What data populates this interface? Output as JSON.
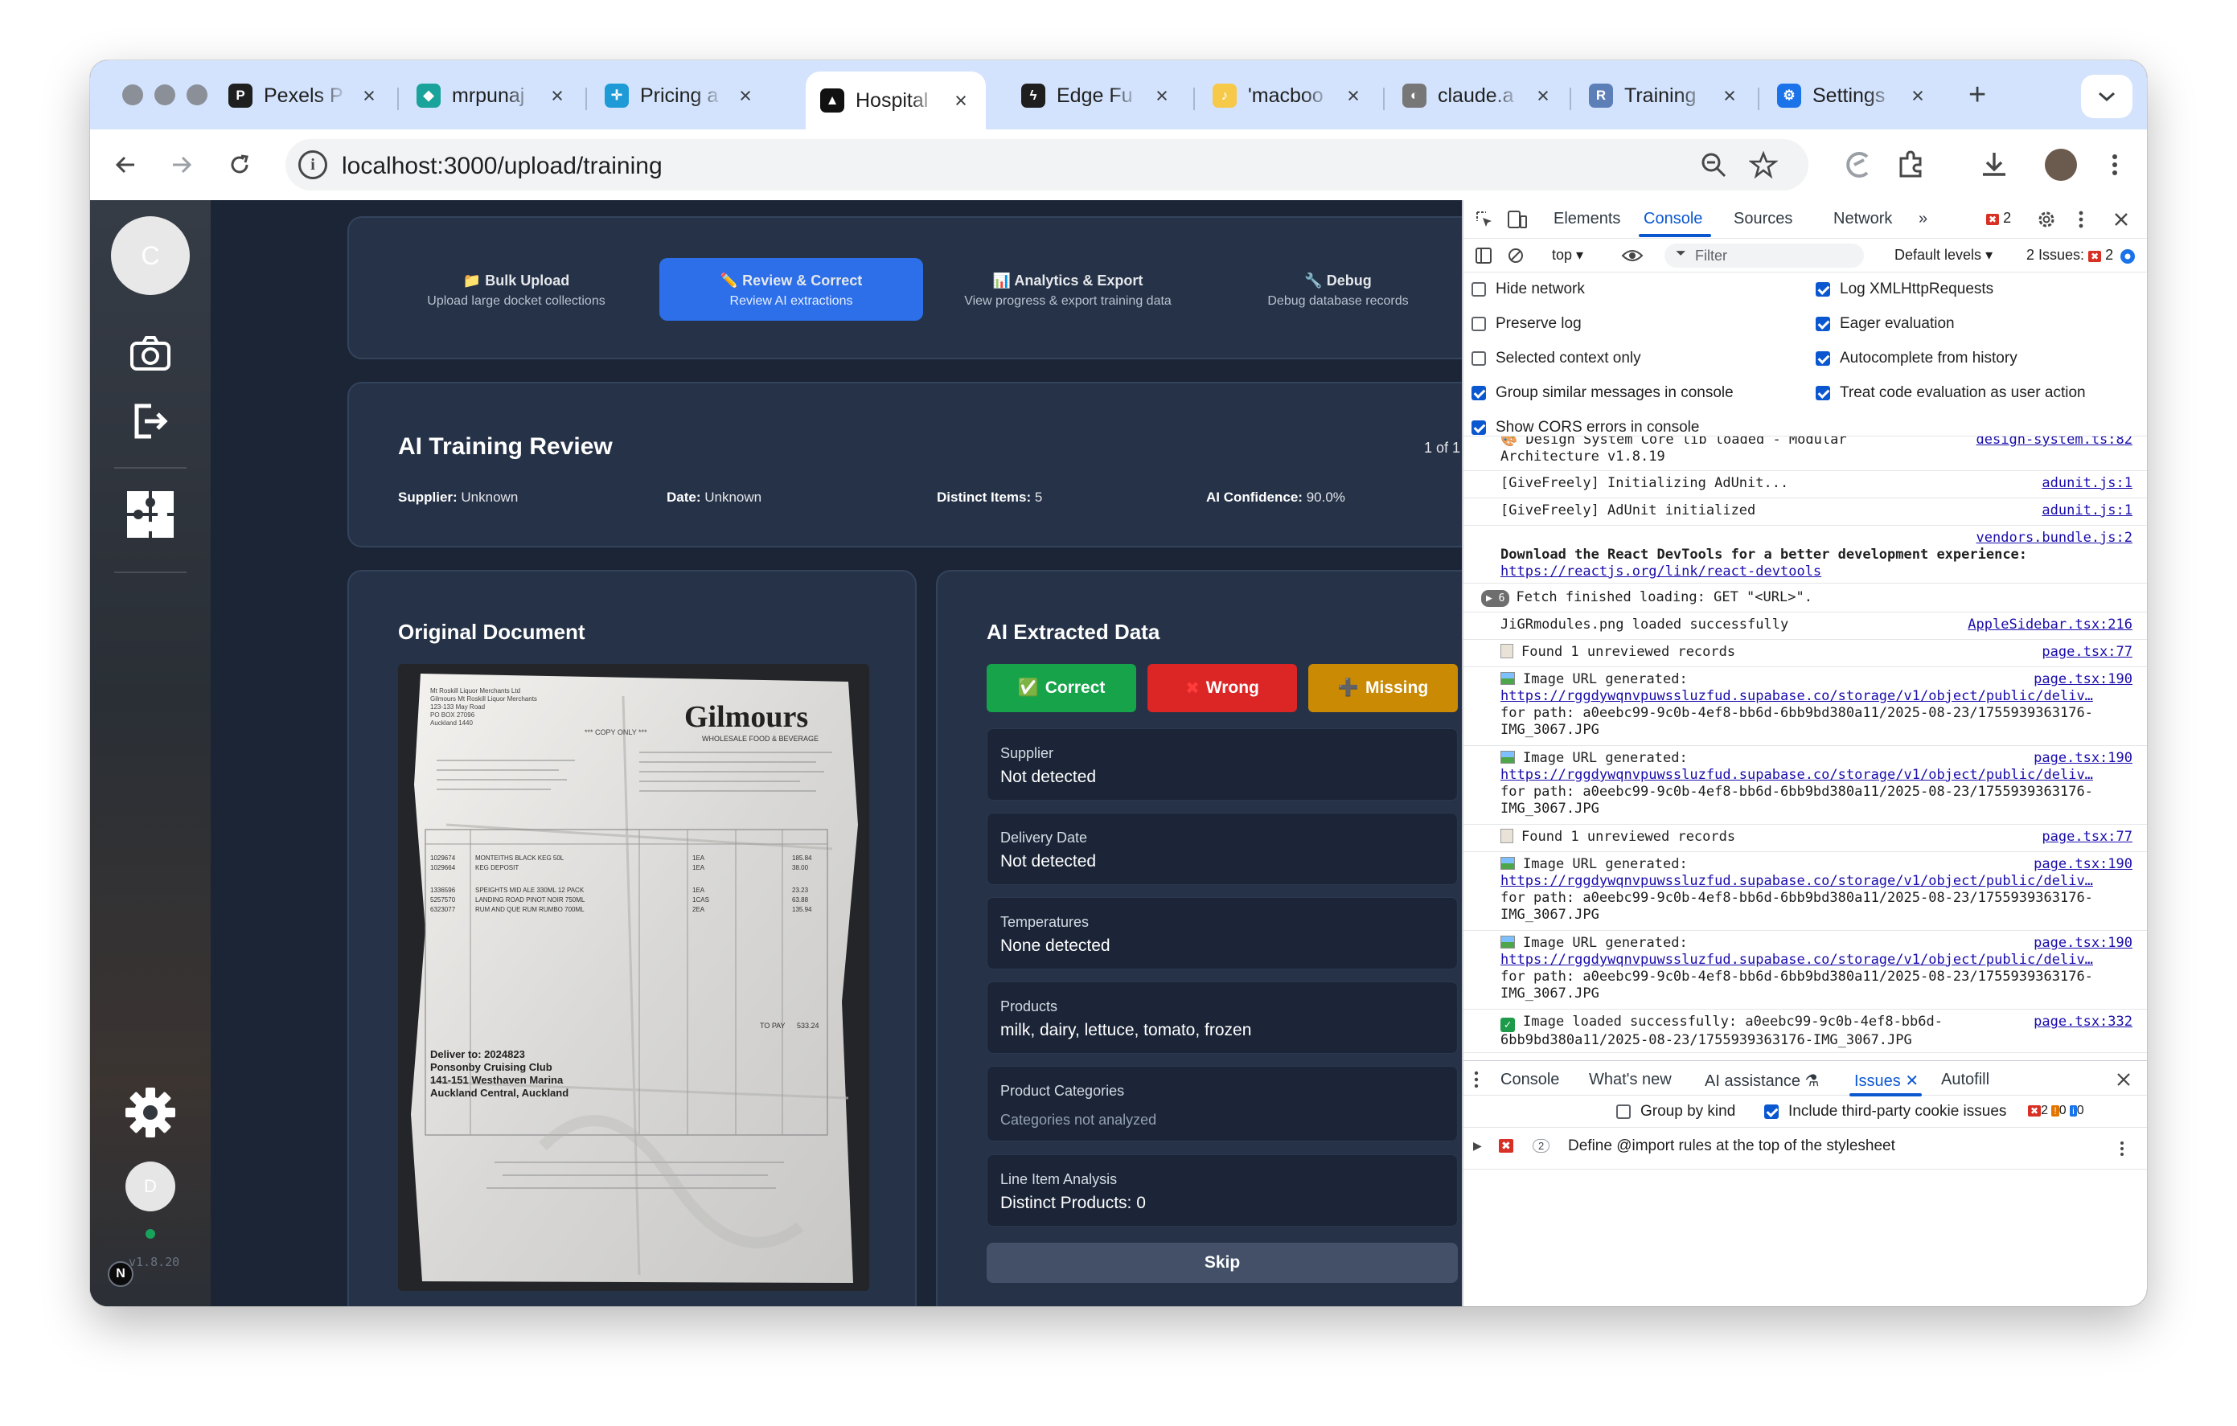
{
  "browser": {
    "tabs": [
      {
        "title": "Pexels P",
        "icon": "pexels",
        "color": "#1f1f1f",
        "glyph": "P"
      },
      {
        "title": "mrpunaj",
        "icon": "diamond",
        "color": "#1aa39a",
        "glyph": "◆"
      },
      {
        "title": "Pricing a",
        "icon": "sparkle",
        "color": "#1e9bd7",
        "glyph": "✛"
      },
      {
        "title": "Hospital",
        "icon": "triangle",
        "color": "#111111",
        "glyph": "▲"
      },
      {
        "title": "Edge Fu",
        "icon": "bolt",
        "color": "#1e1e1e",
        "glyph": "ϟ"
      },
      {
        "title": "'macboo",
        "icon": "note",
        "color": "#f7c948",
        "glyph": "♪"
      },
      {
        "title": "claude.a",
        "icon": "globe",
        "color": "#777777",
        "glyph": "◐"
      },
      {
        "title": "Training",
        "icon": "repo",
        "color": "#5d7fb8",
        "glyph": "R"
      },
      {
        "title": "Settings",
        "icon": "gear",
        "color": "#1a73e8",
        "glyph": "⚙"
      }
    ],
    "active_tab_index": 3,
    "url": "localhost:3000/upload/training"
  },
  "sidebar": {
    "avatar_initial": "C",
    "user_initial": "D",
    "version": "v1.8.20",
    "badge": "N"
  },
  "nav_tabs": [
    {
      "title": "📁 Bulk Upload",
      "subtitle": "Upload large docket collections"
    },
    {
      "title": "✏️ Review & Correct",
      "subtitle": "Review AI extractions"
    },
    {
      "title": "📊 Analytics & Export",
      "subtitle": "View progress & export training data"
    },
    {
      "title": "🔧 Debug",
      "subtitle": "Debug database records"
    }
  ],
  "review": {
    "title": "AI Training Review",
    "counter": "1 of 1",
    "supplier_label": "Supplier:",
    "supplier": "Unknown",
    "date_label": "Date:",
    "date": "Unknown",
    "items_label": "Distinct Items:",
    "items": "5",
    "confidence_label": "AI Confidence:",
    "confidence": "90.0%"
  },
  "document": {
    "heading": "Original Document",
    "company": "Gilmours",
    "tagline": "WHOLESALE FOOD & BEVERAGE",
    "copy_only": "*** COPY ONLY ***",
    "deliver_to": "Deliver to: 2024823",
    "club": "Ponsonby Cruising Club",
    "address1": "141-151 Westhaven Marina",
    "address2": "Auckland Central, Auckland",
    "to_pay": "TO PAY",
    "total": "533.24",
    "header_lines": [
      "Mt Roskill Liquor Merchants Ltd",
      "Gilmours Mt Roskill Liquor Merchants",
      "123-133 May Road",
      "PO BOX 27096",
      "Auckland 1440"
    ],
    "items": [
      {
        "code": "1029674",
        "desc": "MONTEITHS BLACK KEG 50L",
        "qty": "1EA",
        "amt": "185.84"
      },
      {
        "code": "1029664",
        "desc": "KEG DEPOSIT",
        "qty": "1EA",
        "amt": "38.00"
      },
      {
        "code": "1336596",
        "desc": "SPEIGHTS MID ALE 330ML 12 PACK",
        "qty": "1EA",
        "amt": "23.23"
      },
      {
        "code": "5257570",
        "desc": "LANDING ROAD PINOT NOIR 750ML",
        "qty": "1CAS",
        "amt": "63.88"
      },
      {
        "code": "6323077",
        "desc": "RUM AND QUE RUM RUMBO 700ML",
        "qty": "2EA",
        "amt": "135.94"
      }
    ]
  },
  "extracted": {
    "heading": "AI Extracted Data",
    "btn_correct": "Correct",
    "btn_wrong": "Wrong",
    "btn_missing": "Missing",
    "fields": [
      {
        "label": "Supplier",
        "value": "Not detected"
      },
      {
        "label": "Delivery Date",
        "value": "Not detected"
      },
      {
        "label": "Temperatures",
        "value": "None detected"
      },
      {
        "label": "Products",
        "value": "milk, dairy, lettuce, tomato, frozen"
      },
      {
        "label": "Product Categories",
        "value": "Categories not analyzed"
      },
      {
        "label": "Line Item Analysis",
        "value": "Distinct Products: 0"
      }
    ],
    "skip": "Skip"
  },
  "devtools": {
    "tabs": [
      "Elements",
      "Console",
      "Sources",
      "Network"
    ],
    "active_tab": "Console",
    "error_count": "2",
    "context": "top",
    "filter_placeholder": "Filter",
    "levels": "Default levels",
    "issues": "2 Issues:",
    "issues_count": "2",
    "settings_left": [
      {
        "label": "Hide network",
        "checked": false
      },
      {
        "label": "Preserve log",
        "checked": false
      },
      {
        "label": "Selected context only",
        "checked": false
      },
      {
        "label": "Group similar messages in console",
        "checked": true
      },
      {
        "label": "Show CORS errors in console",
        "checked": true
      }
    ],
    "settings_right": [
      {
        "label": "Log XMLHttpRequests",
        "checked": true
      },
      {
        "label": "Eager evaluation",
        "checked": true
      },
      {
        "label": "Autocomplete from history",
        "checked": true
      },
      {
        "label": "Treat code evaluation as user action",
        "checked": true
      }
    ],
    "logs": {
      "design_a": "🎨 Design System Core lib loaded - Modular",
      "design_b": "Architecture v1.8.19",
      "design_src": "design-system.ts:82",
      "give1": "[GiveFreely] Initializing AdUnit...",
      "give1_src": "adunit.js:1",
      "give2": "[GiveFreely] AdUnit initialized",
      "give2_src": "adunit.js:1",
      "vendors_src": "vendors.bundle.js:2",
      "react1": "Download the React DevTools for a better development experience:",
      "react2": "https://reactjs.org/link/react-devtools",
      "fetch_count": "6",
      "fetch": "Fetch finished loading: GET \"<URL>\".",
      "jigr": "JiGRmodules.png loaded successfully",
      "jigr_src": "AppleSidebar.tsx:216",
      "found": "Found 1 unreviewed records",
      "found_src": "page.tsx:77",
      "img_gen": "Image URL generated:",
      "img_src": "page.tsx:190",
      "img_url": "https://rggdywqnvpuwssluzfud.supabase.co/storage/v1/object/public/deliv…",
      "path1": "for path: a0eebc99-9c0b-4ef8-bb6d-6bb9bd380a11/2025-08-23/1755939363176-",
      "path2": "IMG_3067.JPG",
      "loaded1": "Image loaded successfully: a0eebc99-9c0b-4ef8-bb6d-",
      "loaded2": "6bb9bd380a11/2025-08-23/1755939363176-IMG_3067.JPG",
      "loaded_src": "page.tsx:332"
    },
    "drawer_tabs": [
      "Console",
      "What's new",
      "AI assistance",
      "Issues",
      "Autofill"
    ],
    "drawer_active": "Issues",
    "group_by_kind": "Group by kind",
    "third_party": "Include third-party cookie issues",
    "count_err": "2",
    "count_warn": "0",
    "count_info": "0",
    "issue_count": "2",
    "issue_text": "Define @import rules at the top of the stylesheet"
  }
}
